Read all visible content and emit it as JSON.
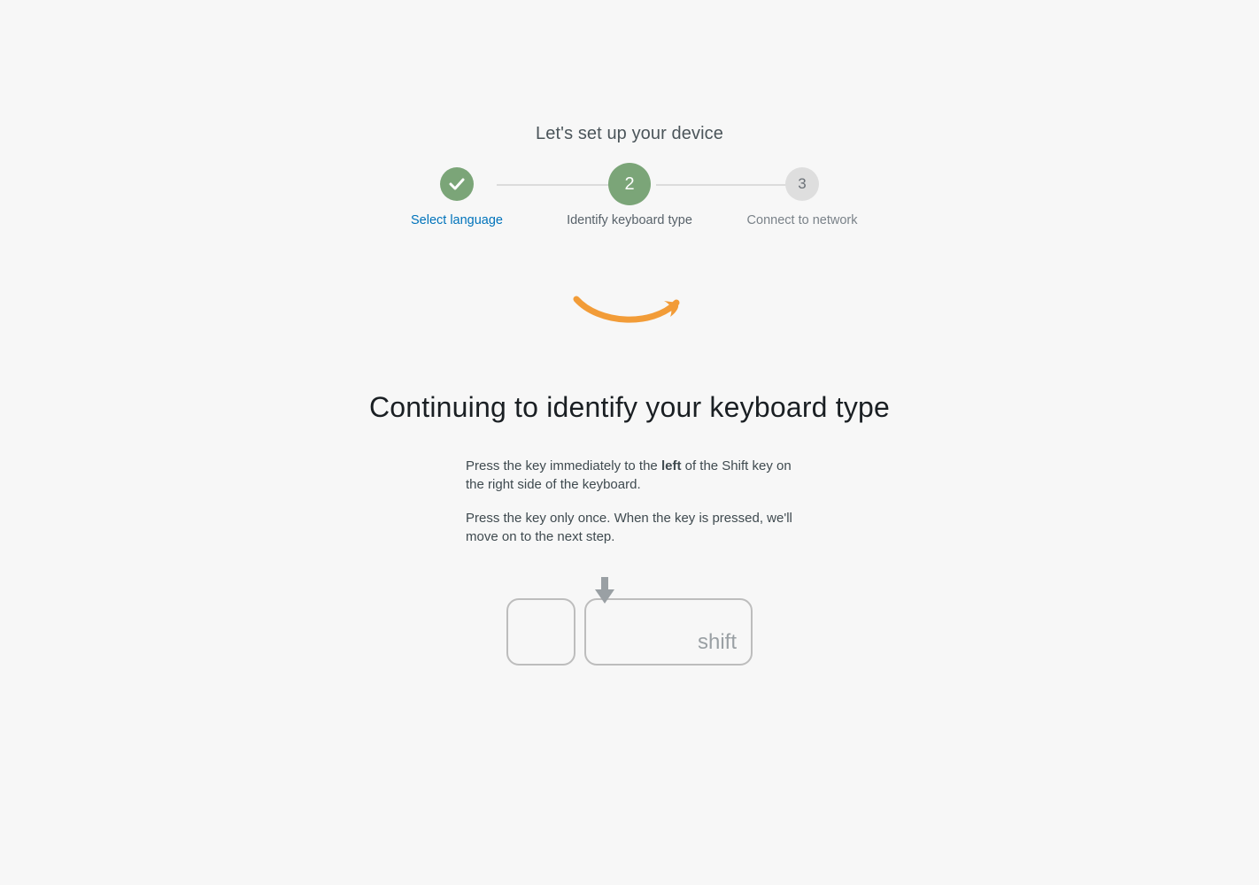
{
  "header": {
    "title": "Let's set up your device"
  },
  "steps": {
    "step1": {
      "label": "Select language"
    },
    "step2": {
      "label": "Identify keyboard type",
      "number": "2"
    },
    "step3": {
      "label": "Connect to network",
      "number": "3"
    }
  },
  "main": {
    "heading": "Continuing to identify your keyboard type",
    "para1_pre": "Press the key immediately to the ",
    "para1_bold": "left",
    "para1_post": " of the Shift key on the right side of the keyboard.",
    "para2": "Press the key only once. When the key is pressed, we'll move on to the next step.",
    "shift_label": "shift"
  },
  "colors": {
    "step_green": "#7ba578",
    "step_gray": "#dedede",
    "link_blue": "#0073bb",
    "smile_orange": "#f29c38"
  }
}
